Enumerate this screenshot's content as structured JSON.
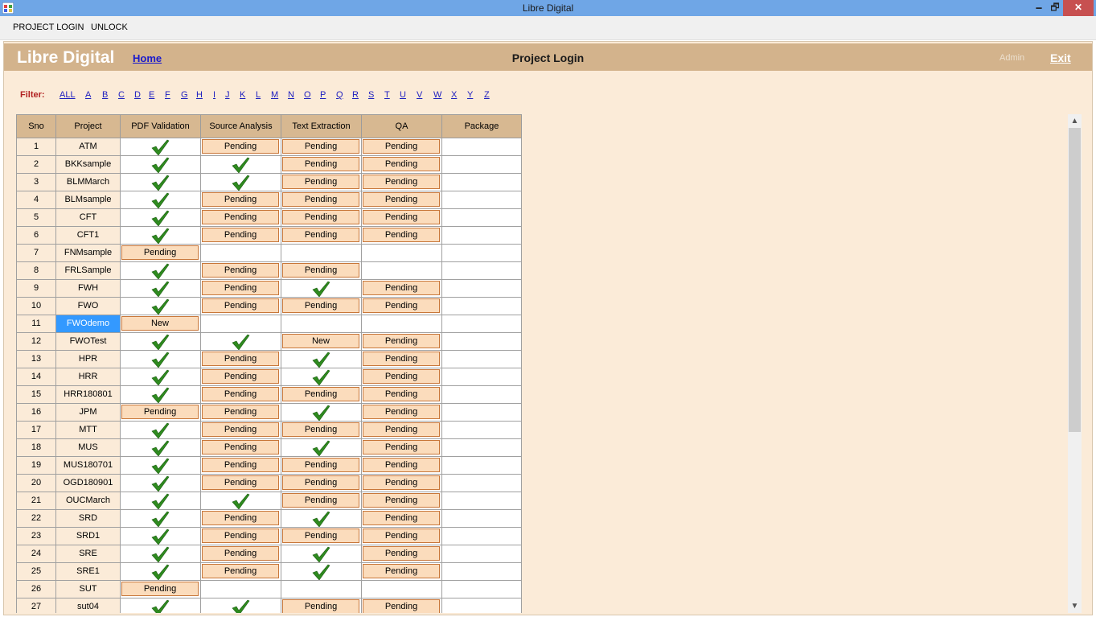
{
  "window": {
    "title": "Libre Digital",
    "min": "🗕",
    "max": "🗗",
    "close": "✕"
  },
  "menu": {
    "items": [
      "PROJECT LOGIN",
      "UNLOCK"
    ]
  },
  "header": {
    "brand": "Libre Digital",
    "home": "Home",
    "page_title": "Project Login",
    "admin": "Admin",
    "exit": "Exit"
  },
  "filter": {
    "label": "Filter:",
    "letters": [
      "ALL",
      "A",
      "B",
      "C",
      "D",
      "E",
      "F",
      "G",
      "H",
      "I",
      "J",
      "K",
      "L",
      "M",
      "N",
      "O",
      "P",
      "Q",
      "R",
      "S",
      "T",
      "U",
      "V",
      "W",
      "X",
      "Y",
      "Z"
    ]
  },
  "table": {
    "columns": [
      "Sno",
      "Project",
      "PDF Validation",
      "Source Analysis",
      "Text Extraction",
      "QA",
      "Package"
    ],
    "selected_row": 11,
    "rows": [
      [
        "1",
        "ATM",
        "check",
        "Pending",
        "Pending",
        "Pending",
        ""
      ],
      [
        "2",
        "BKKsample",
        "check",
        "check",
        "Pending",
        "Pending",
        ""
      ],
      [
        "3",
        "BLMMarch",
        "check",
        "check",
        "Pending",
        "Pending",
        ""
      ],
      [
        "4",
        "BLMsample",
        "check",
        "Pending",
        "Pending",
        "Pending",
        ""
      ],
      [
        "5",
        "CFT",
        "check",
        "Pending",
        "Pending",
        "Pending",
        ""
      ],
      [
        "6",
        "CFT1",
        "check",
        "Pending",
        "Pending",
        "Pending",
        ""
      ],
      [
        "7",
        "FNMsample",
        "Pending",
        "",
        "",
        "",
        ""
      ],
      [
        "8",
        "FRLSample",
        "check",
        "Pending",
        "Pending",
        "",
        ""
      ],
      [
        "9",
        "FWH",
        "check",
        "Pending",
        "check",
        "Pending",
        ""
      ],
      [
        "10",
        "FWO",
        "check",
        "Pending",
        "Pending",
        "Pending",
        ""
      ],
      [
        "11",
        "FWOdemo",
        "New",
        "",
        "",
        "",
        ""
      ],
      [
        "12",
        "FWOTest",
        "check",
        "check",
        "New",
        "Pending",
        ""
      ],
      [
        "13",
        "HPR",
        "check",
        "Pending",
        "check",
        "Pending",
        ""
      ],
      [
        "14",
        "HRR",
        "check",
        "Pending",
        "check",
        "Pending",
        ""
      ],
      [
        "15",
        "HRR180801",
        "check",
        "Pending",
        "Pending",
        "Pending",
        ""
      ],
      [
        "16",
        "JPM",
        "Pending",
        "Pending",
        "check",
        "Pending",
        ""
      ],
      [
        "17",
        "MTT",
        "check",
        "Pending",
        "Pending",
        "Pending",
        ""
      ],
      [
        "18",
        "MUS",
        "check",
        "Pending",
        "check",
        "Pending",
        ""
      ],
      [
        "19",
        "MUS180701",
        "check",
        "Pending",
        "Pending",
        "Pending",
        ""
      ],
      [
        "20",
        "OGD180901",
        "check",
        "Pending",
        "Pending",
        "Pending",
        ""
      ],
      [
        "21",
        "OUCMarch",
        "check",
        "check",
        "Pending",
        "Pending",
        ""
      ],
      [
        "22",
        "SRD",
        "check",
        "Pending",
        "check",
        "Pending",
        ""
      ],
      [
        "23",
        "SRD1",
        "check",
        "Pending",
        "Pending",
        "Pending",
        ""
      ],
      [
        "24",
        "SRE",
        "check",
        "Pending",
        "check",
        "Pending",
        ""
      ],
      [
        "25",
        "SRE1",
        "check",
        "Pending",
        "check",
        "Pending",
        ""
      ],
      [
        "26",
        "SUT",
        "Pending",
        "",
        "",
        "",
        ""
      ],
      [
        "27",
        "sut04",
        "check",
        "check",
        "Pending",
        "Pending",
        ""
      ]
    ]
  },
  "colors": {
    "header_bg": "#d3b38c",
    "content_bg": "#fbebd8",
    "pill_bg": "#fbdcbc",
    "pill_border": "#c8773a",
    "selected": "#3399ff",
    "check": "#2e8b1f"
  },
  "icons": {
    "check": "check-icon",
    "scroll_up": "scroll-up-icon",
    "scroll_down": "scroll-down-icon"
  }
}
